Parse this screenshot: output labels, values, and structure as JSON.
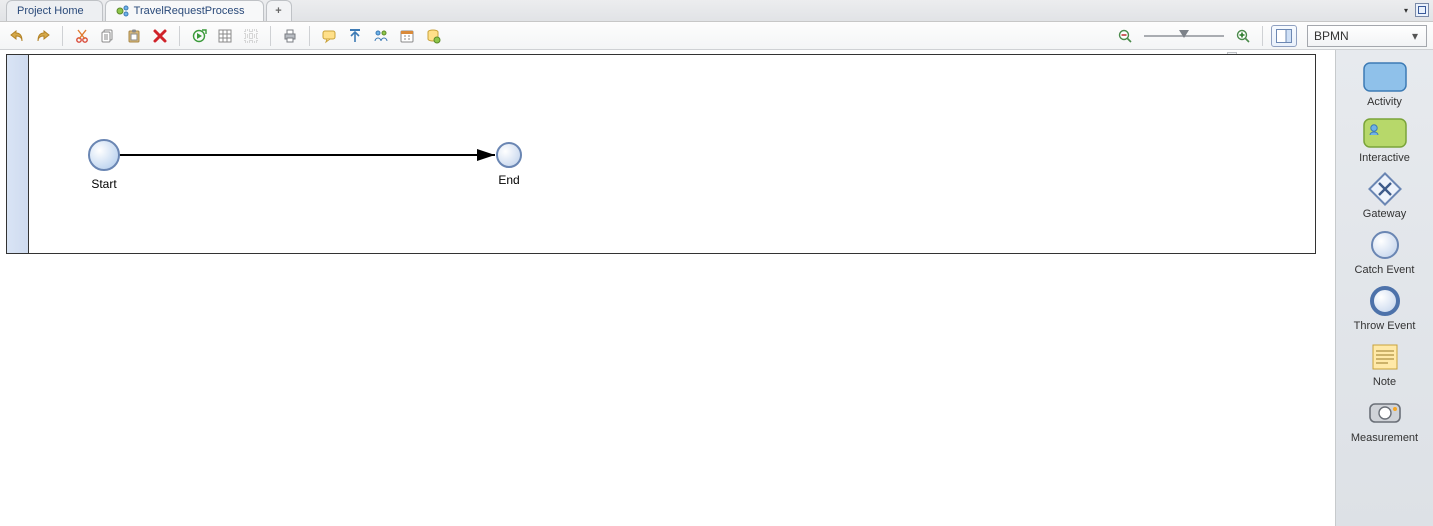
{
  "tabs": {
    "project_home": "Project Home",
    "process_name": "TravelRequestProcess",
    "add": "+"
  },
  "toolbar": {
    "icons": {
      "undo": "undo-icon",
      "redo": "redo-icon",
      "cut": "cut-icon",
      "copy": "copy-icon",
      "paste": "paste-icon",
      "delete": "delete-icon",
      "simulate": "simulate-icon",
      "grid": "grid-icon",
      "align": "align-icon",
      "print": "print-icon",
      "annotation": "annotation-icon",
      "share": "share-icon",
      "roles": "roles-icon",
      "calendar": "calendar-icon",
      "data": "data-icon"
    }
  },
  "zoom": {
    "value": 100
  },
  "notation": {
    "selected": "BPMN"
  },
  "diagram": {
    "start_label": "Start",
    "end_label": "End"
  },
  "palette": {
    "items": [
      {
        "key": "activity",
        "label": "Activity"
      },
      {
        "key": "interactive",
        "label": "Interactive"
      },
      {
        "key": "gateway",
        "label": "Gateway"
      },
      {
        "key": "catch_event",
        "label": "Catch Event"
      },
      {
        "key": "throw_event",
        "label": "Throw Event"
      },
      {
        "key": "note",
        "label": "Note"
      },
      {
        "key": "measurement",
        "label": "Measurement"
      }
    ]
  }
}
